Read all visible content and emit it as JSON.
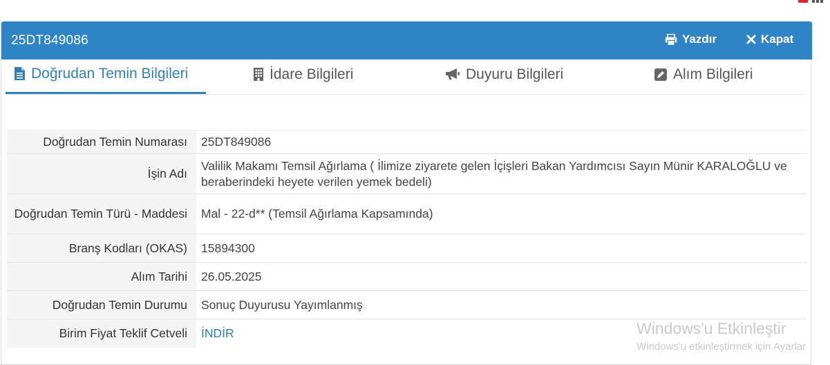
{
  "header": {
    "title": "25DT849086",
    "print_label": "Yazdır",
    "close_label": "Kapat"
  },
  "tabs": [
    {
      "label": "Doğrudan Temin Bilgileri",
      "icon": "document-icon",
      "active": true
    },
    {
      "label": "İdare Bilgileri",
      "icon": "building-icon",
      "active": false
    },
    {
      "label": "Duyuru Bilgileri",
      "icon": "megaphone-icon",
      "active": false
    },
    {
      "label": "Alım Bilgileri",
      "icon": "edit-icon",
      "active": false
    }
  ],
  "details": {
    "rows": [
      {
        "label": "Doğrudan Temin Numarası",
        "value": "25DT849086"
      },
      {
        "label": "İşin Adı",
        "value": "Valilik Makamı Temsil Ağırlama ( İlimize ziyarete gelen İçişleri Bakan Yardımcısı Sayın Münir KARALOĞLU ve beraberindeki heyete verilen yemek bedeli)"
      },
      {
        "label": "Doğrudan Temin Türü - Maddesi",
        "value": "Mal - 22-d** (Temsil Ağırlama Kapsamında)"
      },
      {
        "label": "Branş Kodları (OKAS)",
        "value": "15894300"
      },
      {
        "label": "Alım Tarihi",
        "value": "26.05.2025"
      },
      {
        "label": "Doğrudan Temin Durumu",
        "value": "Sonuç Duyurusu Yayımlanmış"
      },
      {
        "label": "Birim Fiyat Teklif Cetveli",
        "value": "İNDİR"
      }
    ]
  },
  "watermark": {
    "line1": "Windows'u Etkinleştir",
    "line2": "Windows'u etkinleştirmek için Ayarlar"
  },
  "colors": {
    "header_bg": "#2e84c4",
    "accent": "#2f7fb9",
    "label_bg": "#f4f4f4"
  }
}
